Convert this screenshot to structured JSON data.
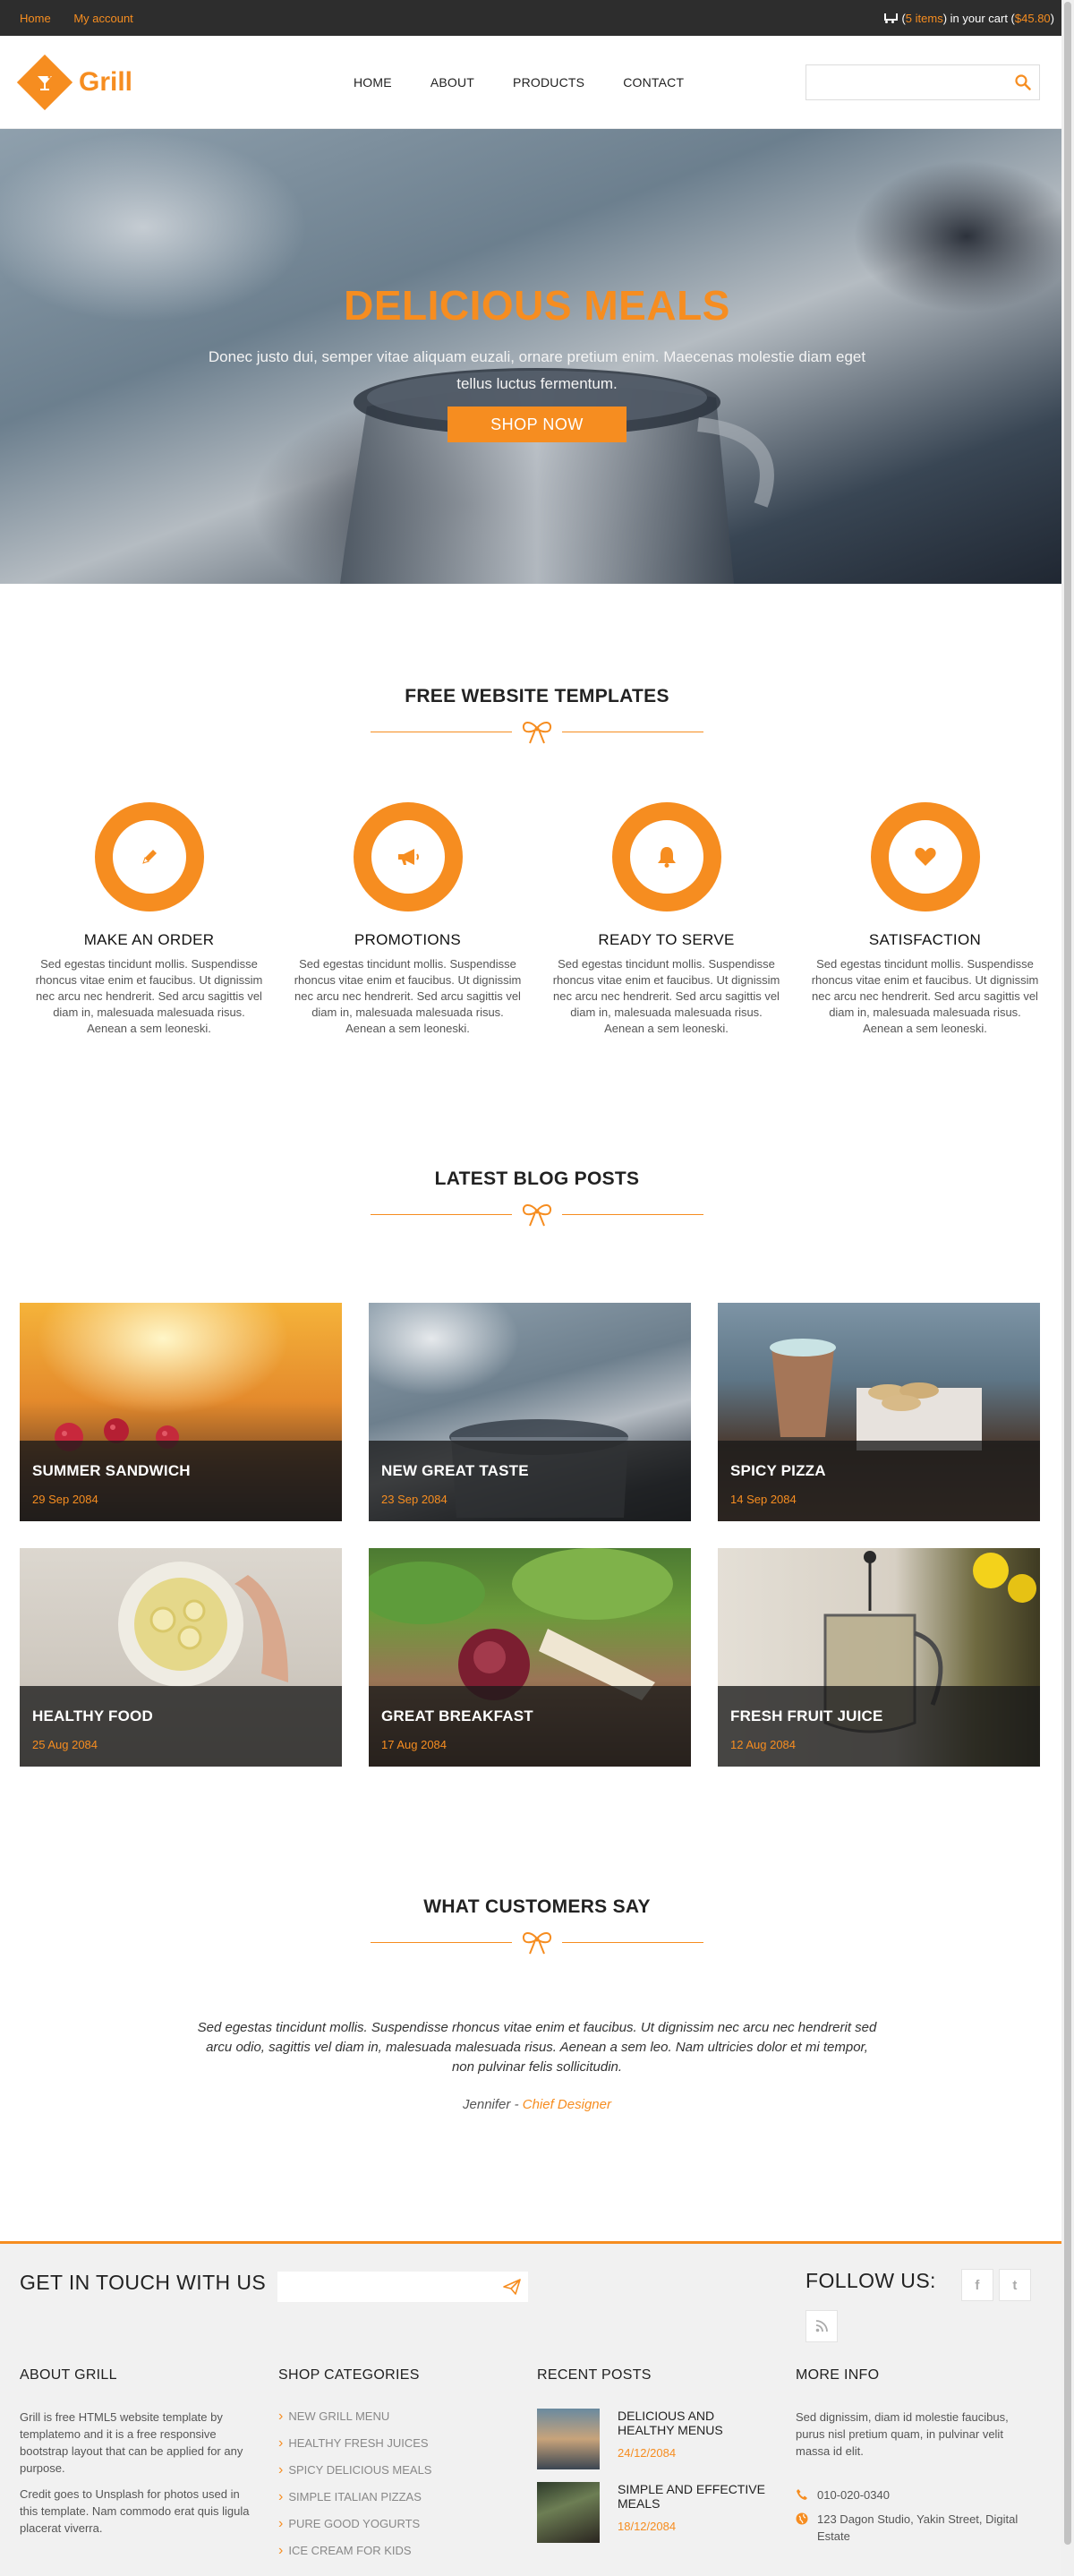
{
  "topbar": {
    "links": [
      "Home",
      "My account"
    ],
    "cart_prefix": "(",
    "cart_items": "5 items",
    "cart_middle": ") in your cart (",
    "cart_total": "$45.80",
    "cart_suffix": ")"
  },
  "header": {
    "logo_text": "Grill",
    "nav": [
      "HOME",
      "ABOUT",
      "PRODUCTS",
      "CONTACT"
    ],
    "search_placeholder": ""
  },
  "hero": {
    "title": "DELICIOUS MEALS",
    "text": "Donec justo dui, semper vitae aliquam euzali, ornare pretium enim. Maecenas molestie diam eget tellus luctus fermentum.",
    "button": "SHOP NOW"
  },
  "features_section": {
    "title": "FREE WEBSITE TEMPLATES",
    "items": [
      {
        "title": "MAKE AN ORDER",
        "icon": "pencil-icon",
        "text": "Sed egestas tincidunt mollis. Suspendisse rhoncus vitae enim et faucibus. Ut dignissim nec arcu nec hendrerit. Sed arcu sagittis vel diam in, malesuada malesuada risus. Aenean a sem leoneski."
      },
      {
        "title": "PROMOTIONS",
        "icon": "bullhorn-icon",
        "text": "Sed egestas tincidunt mollis. Suspendisse rhoncus vitae enim et faucibus. Ut dignissim nec arcu nec hendrerit. Sed arcu sagittis vel diam in, malesuada malesuada risus. Aenean a sem leoneski."
      },
      {
        "title": "READY TO SERVE",
        "icon": "bell-icon",
        "text": "Sed egestas tincidunt mollis. Suspendisse rhoncus vitae enim et faucibus. Ut dignissim nec arcu nec hendrerit. Sed arcu sagittis vel diam in, malesuada malesuada risus. Aenean a sem leoneski."
      },
      {
        "title": "SATISFACTION",
        "icon": "heart-icon",
        "text": "Sed egestas tincidunt mollis. Suspendisse rhoncus vitae enim et faucibus. Ut dignissim nec arcu nec hendrerit. Sed arcu sagittis vel diam in, malesuada malesuada risus. Aenean a sem leoneski."
      }
    ]
  },
  "blog": {
    "title": "LATEST BLOG POSTS",
    "posts": [
      {
        "title": "SUMMER SANDWICH",
        "date": "29 Sep 2084"
      },
      {
        "title": "NEW GREAT TASTE",
        "date": "23 Sep 2084"
      },
      {
        "title": "SPICY PIZZA",
        "date": "14 Sep 2084"
      },
      {
        "title": "HEALTHY FOOD",
        "date": "25 Aug 2084"
      },
      {
        "title": "GREAT BREAKFAST",
        "date": "17 Aug 2084"
      },
      {
        "title": "FRESH FRUIT JUICE",
        "date": "12 Aug 2084"
      }
    ]
  },
  "testimonial": {
    "title": "WHAT CUSTOMERS SAY",
    "quote": "Sed egestas tincidunt mollis. Suspendisse rhoncus vitae enim et faucibus. Ut dignissim nec arcu nec hendrerit sed arcu odio, sagittis vel diam in, malesuada malesuada risus. Aenean a sem leo. Nam ultricies dolor et mi tempor, non pulvinar felis sollicitudin.",
    "author": "Jennifer",
    "separator": " - ",
    "role": "Chief Designer"
  },
  "footer": {
    "touch_title": "GET IN TOUCH WITH US",
    "newsletter_placeholder": "",
    "follow_title": "FOLLOW US:",
    "social": [
      "f",
      "t",
      "rss"
    ],
    "about_title": "ABOUT GRILL",
    "about_p1": "Grill is free HTML5 website template by templatemo and it is a free responsive bootstrap layout that can be applied for any purpose.",
    "about_p2": "Credit goes to Unsplash for photos used in this template. Nam commodo erat quis ligula placerat viverra.",
    "categories_title": "SHOP CATEGORIES",
    "categories": [
      "NEW GRILL MENU",
      "HEALTHY FRESH JUICES",
      "SPICY DELICIOUS MEALS",
      "SIMPLE ITALIAN PIZZAS",
      "PURE GOOD YOGURTS",
      "ICE CREAM FOR KIDS"
    ],
    "recent_title": "RECENT POSTS",
    "recent": [
      {
        "title": "DELICIOUS AND HEALTHY MENUS",
        "date": "24/12/2084"
      },
      {
        "title": "SIMPLE AND EFFECTIVE MEALS",
        "date": "18/12/2084"
      }
    ],
    "info_title": "MORE INFO",
    "info_text": "Sed dignissim, diam id molestie faucibus, purus nisl pretium quam, in pulvinar velit massa id elit.",
    "phone": "010-020-0340",
    "address": "123 Dagon Studio, Yakin Street, Digital Estate"
  },
  "colors": {
    "accent": "#f68d20",
    "topbar": "#2d2d2d",
    "footer_bg": "#f1f1f1"
  }
}
